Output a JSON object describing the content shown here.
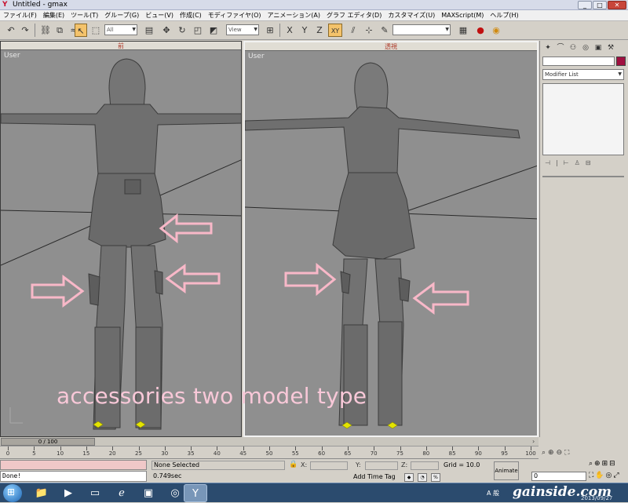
{
  "window": {
    "title": "Untitled - gmax",
    "app_icon": "gmax-logo-icon",
    "controls": [
      "_",
      "□",
      "✕"
    ]
  },
  "menu": [
    "ファイル(F)",
    "編集(E)",
    "ツール(T)",
    "グループ(G)",
    "ビュー(V)",
    "作成(C)",
    "モディファイヤ(O)",
    "アニメーション(A)",
    "グラフ エディタ(D)",
    "カスタマイズ(U)",
    "MAXScript(M)",
    "ヘルプ(H)"
  ],
  "toolbar": {
    "selection_filter": "All",
    "ref_coord": "View",
    "named_selection": "",
    "axis_labels": [
      "X",
      "Y",
      "Z",
      "XY"
    ]
  },
  "viewports": {
    "left": {
      "header": "前",
      "label": "User"
    },
    "right": {
      "header": "透視",
      "label": "User"
    },
    "annotation": "accessories two model type"
  },
  "command_panel": {
    "name_field": "",
    "modifier_list": "Modifier List",
    "accent_color": "#a01040"
  },
  "timeline": {
    "slider_text": "0 / 100",
    "ticks": [
      0,
      5,
      10,
      15,
      20,
      25,
      30,
      35,
      40,
      45,
      50,
      55,
      60,
      65,
      70,
      75,
      80,
      85,
      90,
      95,
      100
    ]
  },
  "status": {
    "listener_output": "Done!",
    "selection": "None Selected",
    "render_time": "0.749sec",
    "x_label": "X:",
    "y_label": "Y:",
    "z_label": "Z:",
    "grid": "Grid = 10.0",
    "add_time_tag": "Add Time Tag",
    "animate": "Animate",
    "frame": "0"
  },
  "taskbar": {
    "language": "A 般",
    "watermark": "gainside.com",
    "date": "2013/09/27"
  }
}
